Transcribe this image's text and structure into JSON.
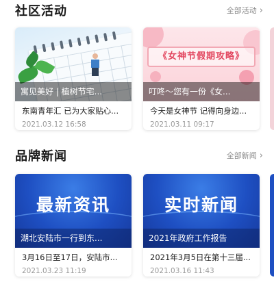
{
  "community": {
    "title": "社区活动",
    "more_label": "全部活动",
    "cards": [
      {
        "overlay": "寓见美好 | 植树节宅...",
        "desc": "东南青年汇 已为大家贴心...",
        "date": "2021.03.12 16:58"
      },
      {
        "overlay": "叮咚～您有一份《女...",
        "desc": "今天是女神节 记得向身边...",
        "date": "2021.03.11 09:17",
        "banner": "《女神节假期攻略》"
      }
    ]
  },
  "news": {
    "title": "品牌新闻",
    "more_label": "全部新闻",
    "cards": [
      {
        "big": "最新资讯",
        "overlay": "湖北安陆市一行到东...",
        "desc": "3月16日至17日，安陆市...",
        "date": "2021.03.23 11:19"
      },
      {
        "big": "实时新闻",
        "overlay": "2021年政府工作报告",
        "desc": "2021年3月5日在第十三届...",
        "date": "2021.03.16 11:43"
      }
    ]
  },
  "icons": {
    "more": "chevron-right-icon"
  }
}
